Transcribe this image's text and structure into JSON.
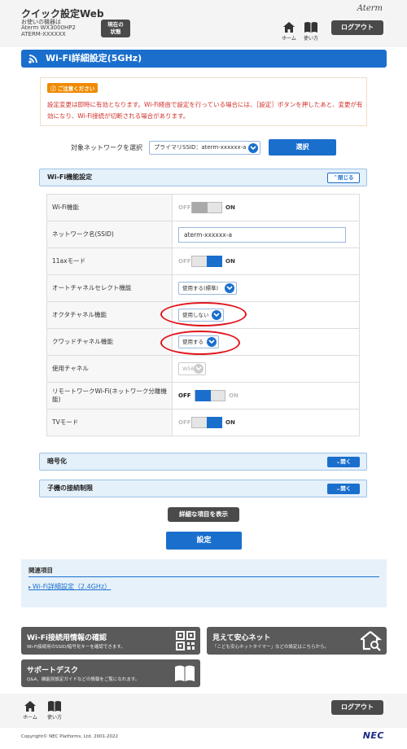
{
  "header": {
    "app_title": "クイック設定Web",
    "device_label": "お使いの機器は",
    "device_model": "Aterm WX3000HP2",
    "device_id": "ATERM-XXXXXX",
    "status_button": "現在の\n状態",
    "brand": "Aterm",
    "nav_home": "ホーム",
    "nav_help": "使い方",
    "logout": "ログアウト"
  },
  "page": {
    "title": "Wi-Fi詳細設定(5GHz)"
  },
  "notice": {
    "heading": "ご注意ください",
    "text": "設定変更は即時に有効となります。Wi-Fi経由で設定を行っている場合には、［設定］ボタンを押したあと、変更が有効になり、Wi-Fi接続が切断される場合があります。"
  },
  "network_select": {
    "label": "対象ネットワークを選択",
    "value": "プライマリSSID：aterm-xxxxxx-a",
    "button": "選択"
  },
  "wifi_section": {
    "title": "Wi-Fi機能設定",
    "toggle_label": "閉じる",
    "rows": [
      {
        "label": "Wi-Fi機能",
        "off": "OFF",
        "on": "ON"
      },
      {
        "label": "ネットワーク名(SSID)",
        "value": "aterm-xxxxxx-a"
      },
      {
        "label": "11axモード",
        "off": "OFF",
        "on": "ON"
      },
      {
        "label": "オートチャネルセレクト機能",
        "value": "使用する(標準)"
      },
      {
        "label": "オクタチャネル機能",
        "value": "使用しない"
      },
      {
        "label": "クワッドチャネル機能",
        "value": "使用する"
      },
      {
        "label": "使用チャネル",
        "value": "W56"
      },
      {
        "label": "リモートワークWi-Fi(ネットワーク分離機能)",
        "off": "OFF",
        "on": "ON"
      },
      {
        "label": "TVモード",
        "off": "OFF",
        "on": "ON"
      }
    ]
  },
  "encryption_section": {
    "title": "暗号化",
    "toggle_label": "開く"
  },
  "client_section": {
    "title": "子機の接続制限",
    "toggle_label": "開く"
  },
  "buttons": {
    "detail": "詳細な項目を表示",
    "apply": "設定"
  },
  "related": {
    "title": "関連項目",
    "link": "Wi-Fi詳細設定（2.4GHz）"
  },
  "cards": [
    {
      "title": "Wi-Fi接続用情報の確認",
      "desc": "Wi-Fi接続用のSSID/暗号化キーを確認できます。",
      "icon": "qr-code-icon"
    },
    {
      "title": "見えて安心ネット",
      "desc": "「こども安心ネットタイマー」などの設定はこちらから。",
      "icon": "house-search-icon"
    },
    {
      "title": "サポートデスク",
      "desc": "Q&A、機能別設定ガイドなどの情報をご覧になれます。",
      "icon": "book-icon"
    }
  ],
  "footer": {
    "nav_home": "ホーム",
    "nav_help": "使い方",
    "logout": "ログアウト",
    "copyright": "Copyright© NEC Platforms, Ltd. 2001-2022",
    "nec": "NEC"
  },
  "colors": {
    "accent": "#1a6fcd",
    "highlight_circle": "#e0161d",
    "notice_text": "#d0302a"
  }
}
